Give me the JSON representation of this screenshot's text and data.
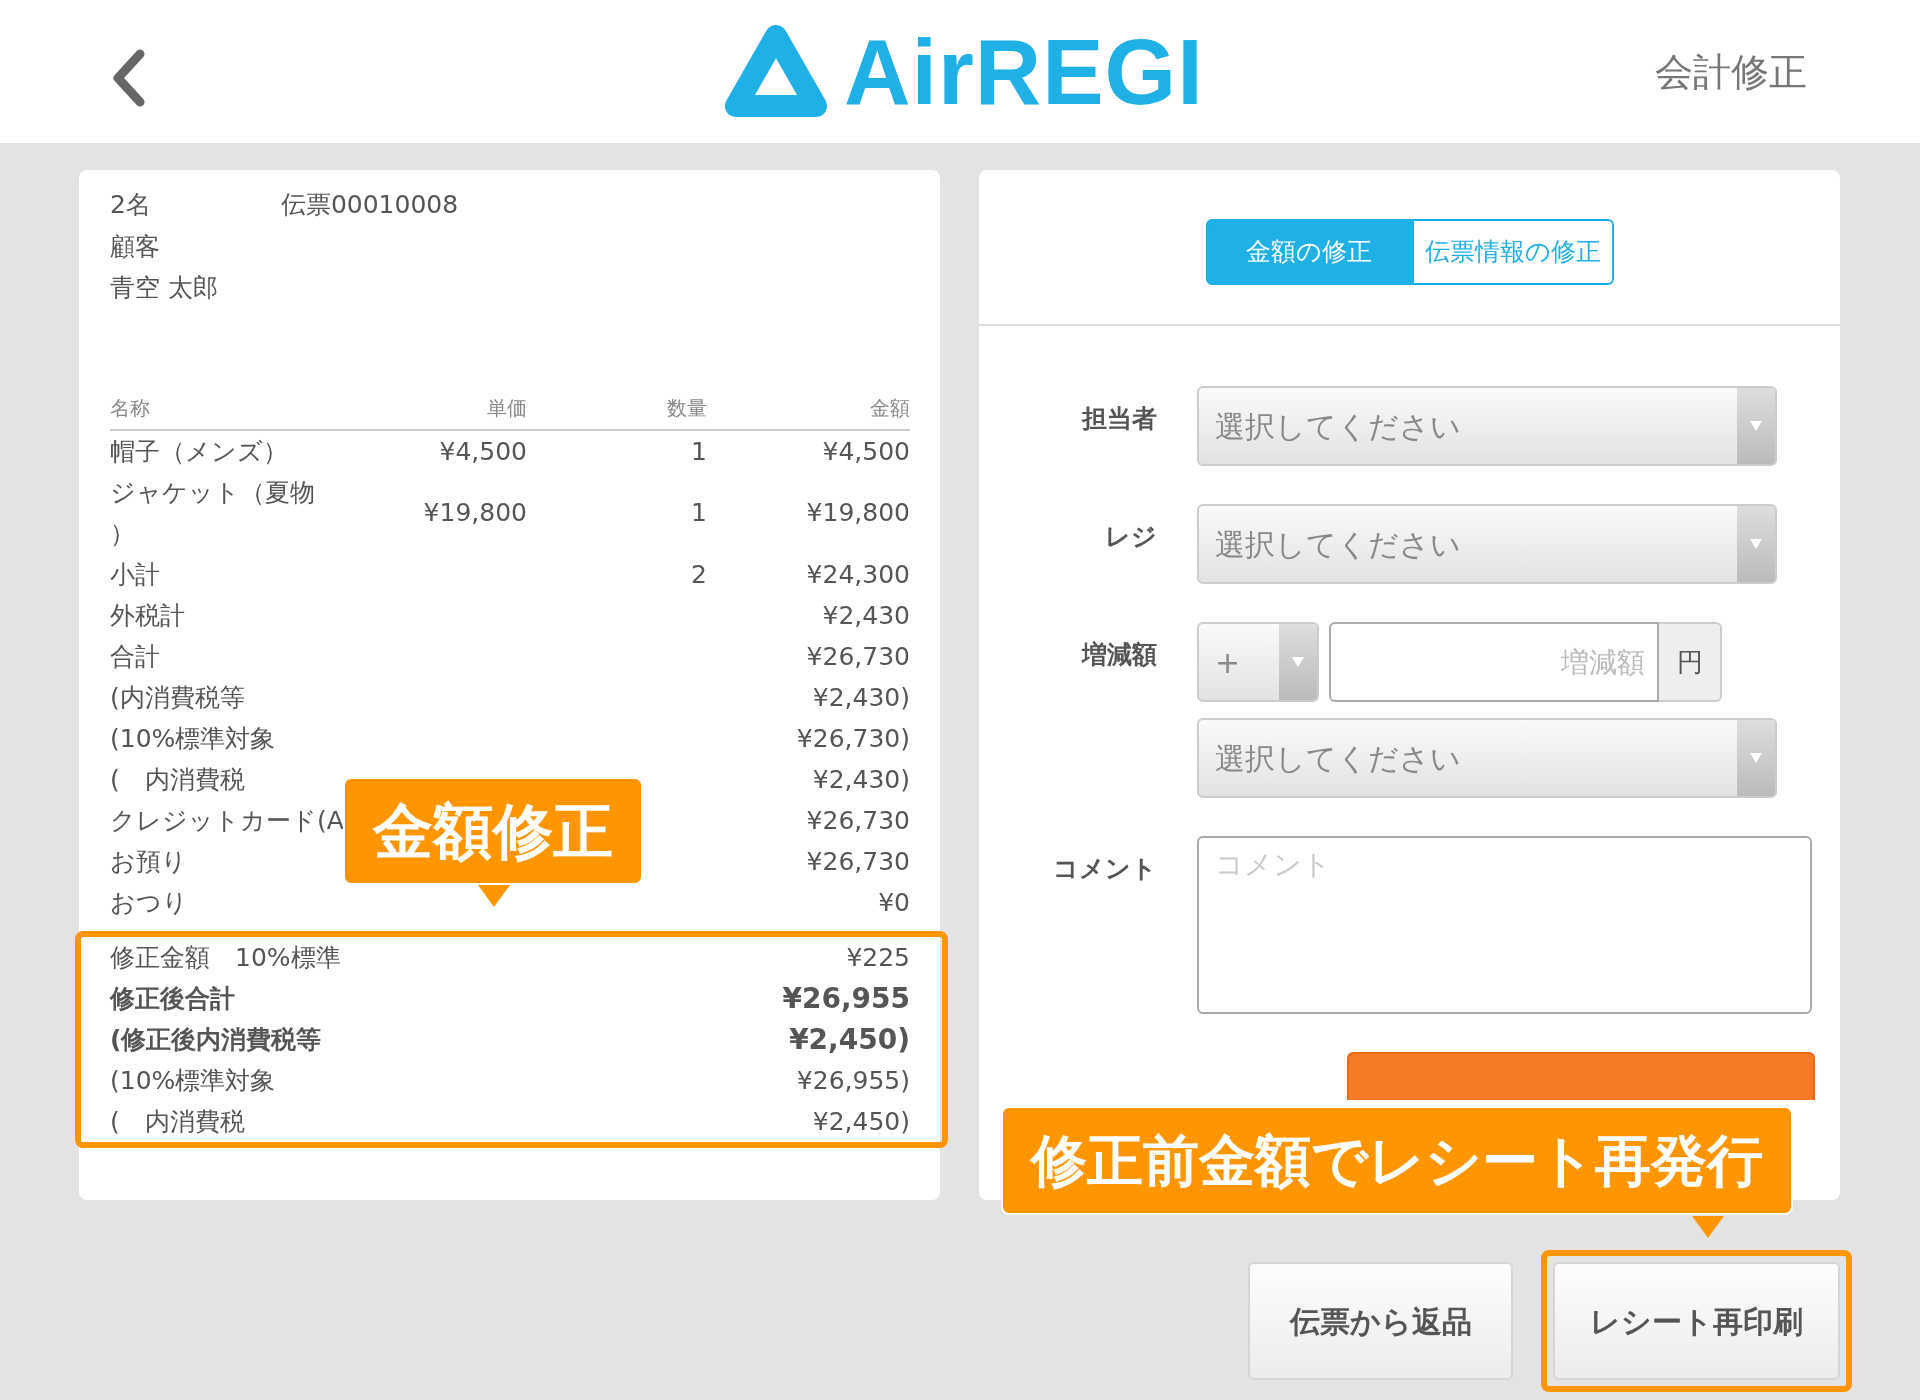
{
  "header": {
    "logo": "AirREGI",
    "title": "会計修正"
  },
  "receipt": {
    "guests": "2名",
    "slip": "伝票00010008",
    "customer_label": "顧客",
    "customer_name": "青空 太郎",
    "columns": [
      "名称",
      "単価",
      "数量",
      "金額"
    ],
    "items": [
      {
        "name": "帽子（メンズ）",
        "unit_price": "¥4,500",
        "quantity": "1",
        "amount": "¥4,500"
      },
      {
        "name": "ジャケット（夏物）",
        "unit_price": "¥19,800",
        "quantity": "1",
        "amount": "¥19,800"
      }
    ],
    "totals": [
      {
        "label": "小計",
        "quantity": "2",
        "amount": "¥24,300"
      },
      {
        "label": "外税計",
        "amount": "¥2,430"
      },
      {
        "label": "合計",
        "amount": "¥26,730"
      },
      {
        "label": "(内消費税等",
        "amount": "¥2,430)"
      },
      {
        "label": "(10%標準対象",
        "amount": "¥26,730)"
      },
      {
        "label": "(　内消費税",
        "amount": "¥2,430)"
      },
      {
        "label": "クレジットカード(A",
        "amount": "¥26,730"
      },
      {
        "label": "お預り",
        "amount": "¥26,730"
      },
      {
        "label": "おつり",
        "amount": "¥0"
      }
    ],
    "corrections": [
      {
        "label": "修正金額　10%標準",
        "amount": "¥225",
        "bold": false
      },
      {
        "label": "修正後合計",
        "amount": "¥26,955",
        "bold": true
      },
      {
        "label": "(修正後内消費税等",
        "amount": "¥2,450)",
        "bold": true
      },
      {
        "label": "(10%標準対象",
        "amount": "¥26,955)",
        "bold": false
      },
      {
        "label": "(　内消費税",
        "amount": "¥2,450)",
        "bold": false
      }
    ]
  },
  "tabs": [
    {
      "label": "金額の修正",
      "selected": true
    },
    {
      "label": "伝票情報の修正",
      "selected": false
    }
  ],
  "form": {
    "staff": {
      "label": "担当者",
      "prompt": "選択してください"
    },
    "register": {
      "label": "レジ",
      "prompt": "選択してください"
    },
    "adjustment": {
      "label": "増減額",
      "sign": "+",
      "placeholder": "増減額",
      "unit": "円",
      "reason_prompt": "選択してください"
    },
    "comment": {
      "label": "コメント",
      "placeholder": "コメント"
    }
  },
  "actions": [
    {
      "label": "伝票から返品",
      "highlighted": false
    },
    {
      "label": "レシート再印刷",
      "highlighted": true
    }
  ],
  "callouts": [
    "金額修正",
    "修正前金額でレシート再発行"
  ]
}
